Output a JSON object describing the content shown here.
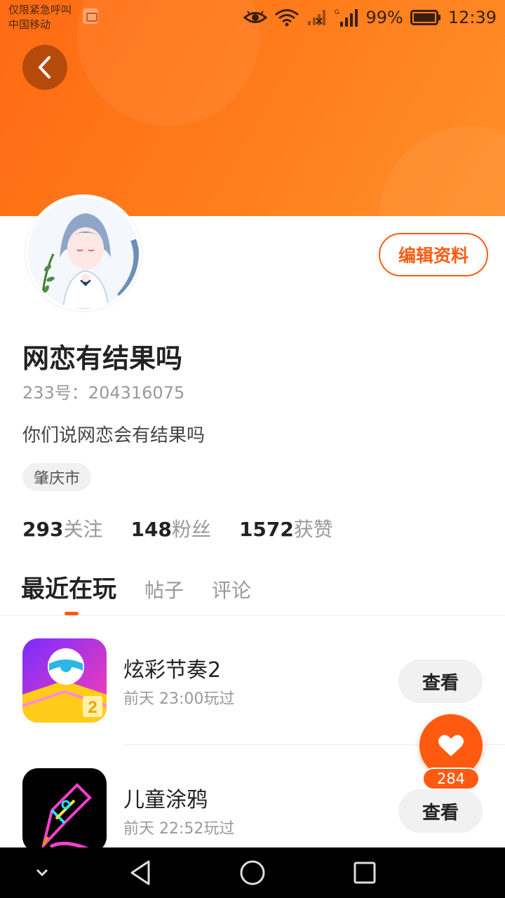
{
  "status_bar": {
    "carrier_line1": "仅限紧急呼叫",
    "carrier_line2": "中国移动",
    "battery_percent": "99%",
    "time": "12:39",
    "icons": [
      "message-icon",
      "eye-icon",
      "wifi-icon",
      "no-signal-icon",
      "signal-icon",
      "battery-icon"
    ]
  },
  "colors": {
    "accent": "#ff5a10",
    "banner": "#ff7a1a"
  },
  "profile": {
    "name": "网恋有结果吗",
    "uid": "233号：204316075",
    "bio": "你们说网恋会有结果吗",
    "location": "肇庆市",
    "edit_label": "编辑资料"
  },
  "stats": [
    {
      "num": "293",
      "label": "关注"
    },
    {
      "num": "148",
      "label": "粉丝"
    },
    {
      "num": "1572",
      "label": "获赞"
    }
  ],
  "tabs": [
    {
      "label": "最近在玩",
      "active": true
    },
    {
      "label": "帖子",
      "active": false
    },
    {
      "label": "评论",
      "active": false
    }
  ],
  "games": [
    {
      "name": "炫彩节奏2",
      "time": "前天 23:00玩过",
      "button": "查看",
      "icon_badge": "2"
    },
    {
      "name": "儿童涂鸦",
      "time": "前天 22:52玩过",
      "button": "查看"
    }
  ],
  "like": {
    "count": "284"
  },
  "nav": [
    "down-chevron-icon",
    "back-triangle-icon",
    "home-circle-icon",
    "recents-square-icon"
  ]
}
